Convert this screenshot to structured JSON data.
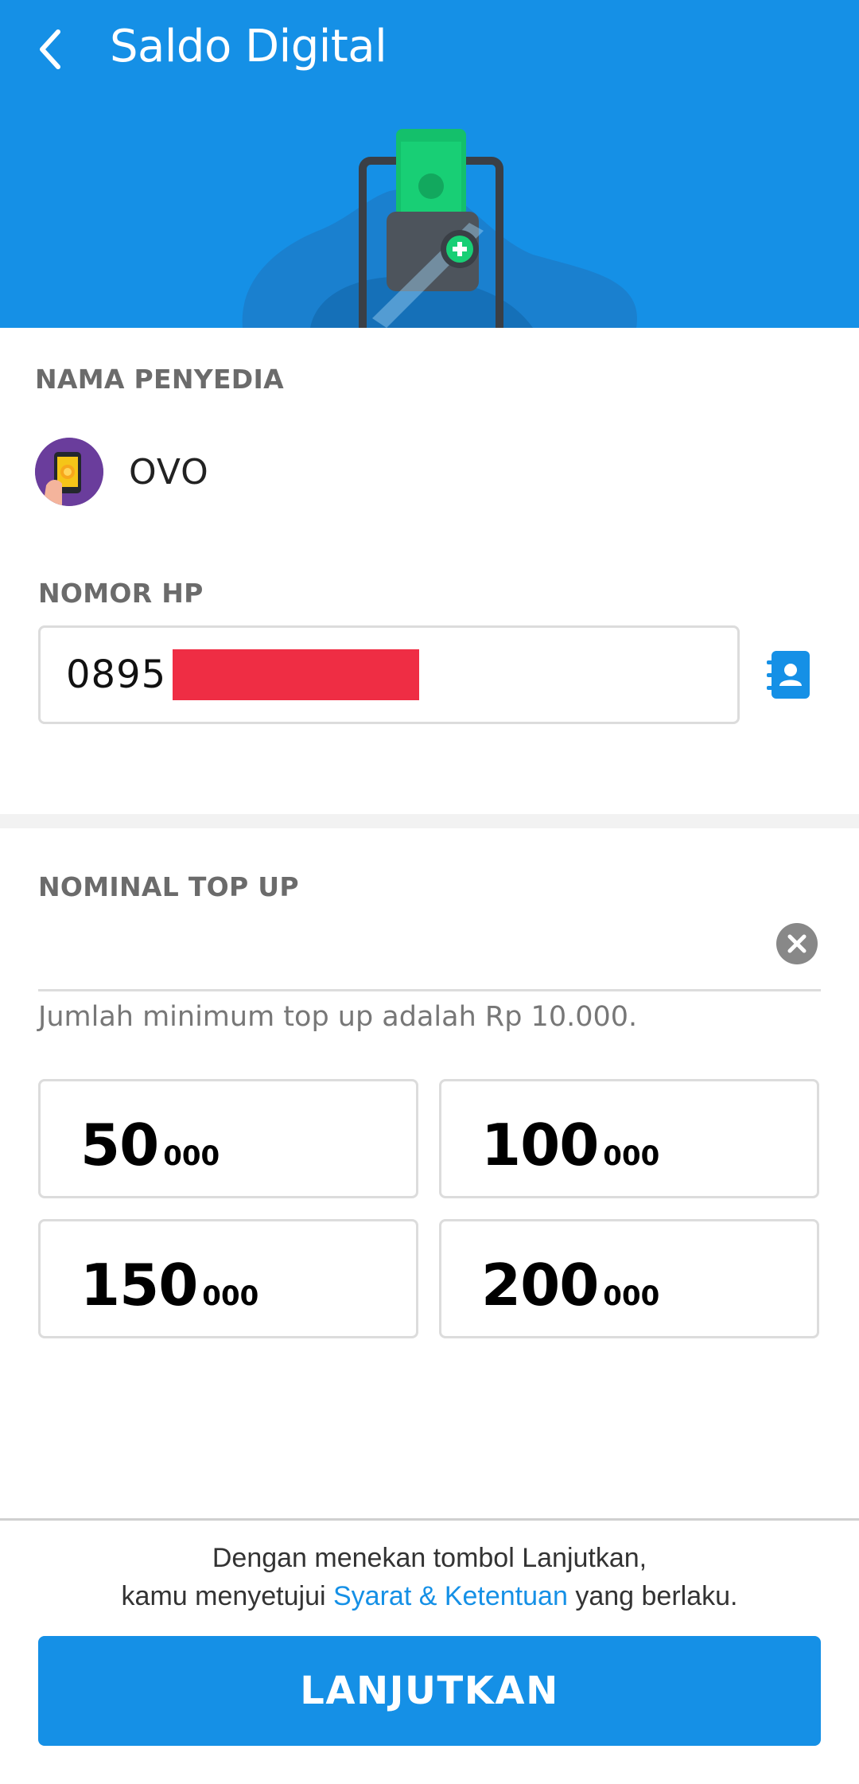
{
  "header": {
    "title": "Saldo Digital",
    "back_icon": "back-arrow-icon",
    "background": "#1590e6"
  },
  "provider": {
    "label": "NAMA PENYEDIA",
    "name": "OVO",
    "icon": "ovo-logo"
  },
  "phone": {
    "label": "NOMOR HP",
    "prefix": "0895",
    "contact_icon": "contact-book-icon"
  },
  "nominal": {
    "label": "NOMINAL TOP UP",
    "value": "",
    "clear_icon": "clear-icon",
    "hint": "Jumlah minimum top up adalah Rp 10.000.",
    "options": [
      {
        "big": "50",
        "small": "000"
      },
      {
        "big": "100",
        "small": "000"
      },
      {
        "big": "150",
        "small": "000"
      },
      {
        "big": "200",
        "small": "000"
      }
    ]
  },
  "footer": {
    "terms_line1": "Dengan menekan tombol Lanjutkan,",
    "terms_prefix": "kamu menyetujui ",
    "terms_link": "Syarat & Ketentuan",
    "terms_suffix": " yang berlaku.",
    "continue_label": "LANJUTKAN"
  },
  "colors": {
    "accent": "#1590e6",
    "redaction": "#ef2d44"
  }
}
